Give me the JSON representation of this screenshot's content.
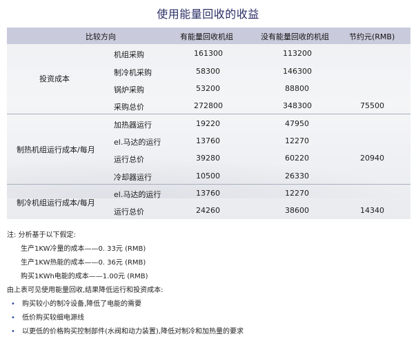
{
  "title": "使用能量回收的收益",
  "table": {
    "headers": [
      "比较方向",
      "有能量回收机组",
      "没有能量回收的机组",
      "节约元(RMB)"
    ],
    "groups": [
      {
        "label": "投资成本",
        "rows": [
          {
            "item": "机组采购",
            "with": "161300",
            "without": "113200"
          },
          {
            "item": "制冷机采购",
            "with": "58300",
            "without": "146300"
          },
          {
            "item": "锅炉采购",
            "with": "53200",
            "without": "88800"
          },
          {
            "item": "采购总价",
            "with": "272800",
            "without": "348300",
            "saving": "75500"
          }
        ]
      },
      {
        "label": "制热机组运行成本/每月",
        "rows": [
          {
            "item": "加热器运行",
            "with": "19220",
            "without": "47950"
          },
          {
            "item": "el.马达的运行",
            "with": "13760",
            "without": "12270"
          },
          {
            "item": "运行总价",
            "with": "39280",
            "without": "60220",
            "saving": "20940"
          },
          {
            "item": "冷却器运行",
            "with": "10500",
            "without": "26330"
          }
        ]
      },
      {
        "label": "制冷机组运行成本/每月",
        "rows": [
          {
            "item": "el.马达的运行",
            "with": "13760",
            "without": "12270"
          },
          {
            "item": "运行总价",
            "with": "24260",
            "without": "38600",
            "saving": "14340"
          }
        ]
      }
    ]
  },
  "notes": {
    "intro": "注:  分析基于以下假定:",
    "assumptions": [
      "生产1KW冷量的成本——0. 33元 (RMB)",
      "生产1KW热能的成本——0. 36元 (RMB)",
      "购买1KWh电能的成本——1.00元 (RMB)"
    ],
    "conclusion": "由上表可见使用能量回收,结果降低运行和投资成本:",
    "bullets": [
      "购买较小的制冷设备,降低了电能的需要",
      "低价购买较细电源线",
      "以更低的价格购买控制部件(水阀和动力装置),降低对制冷和加热量的要求"
    ]
  }
}
